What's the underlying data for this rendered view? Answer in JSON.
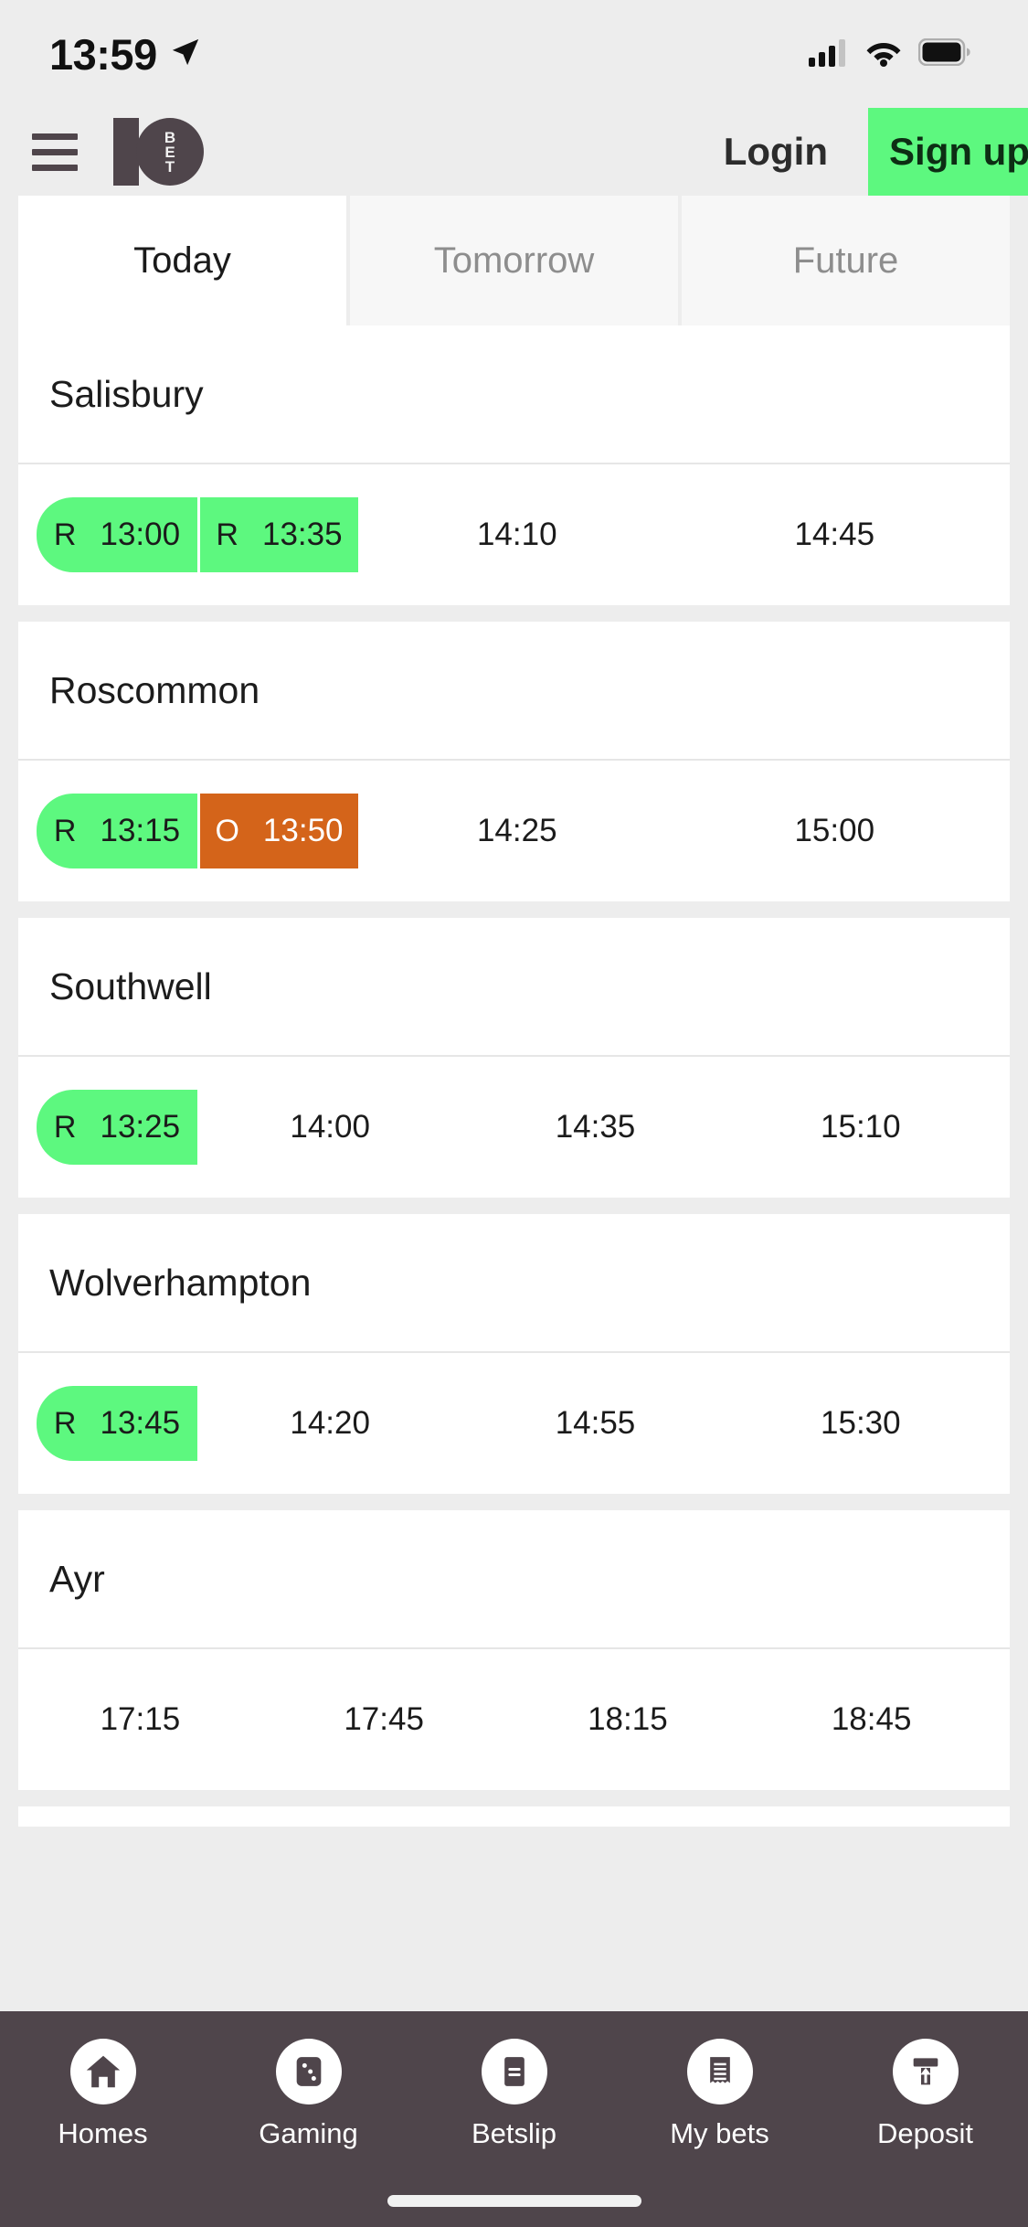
{
  "status_bar": {
    "time": "13:59",
    "location_icon": "location-arrow-icon",
    "cellular_icon": "cellular-signal-icon",
    "wifi_icon": "wifi-icon",
    "battery_icon": "battery-full-icon"
  },
  "header": {
    "menu_icon": "hamburger-menu-icon",
    "logo_digit": "1",
    "logo_letters": [
      "B",
      "E",
      "T"
    ],
    "login_label": "Login",
    "signup_label": "Sign up",
    "signup_bg": "#5df87f"
  },
  "tabs": [
    {
      "label": "Today",
      "active": true
    },
    {
      "label": "Tomorrow",
      "active": false
    },
    {
      "label": "Future",
      "active": false
    }
  ],
  "colors": {
    "green": "#5df87f",
    "orange": "#d4641a",
    "page_bg": "#ededed",
    "nav_bg": "#4f454b",
    "card_bg": "#ffffff"
  },
  "meetings": [
    {
      "venue": "Salisbury",
      "races": [
        {
          "time": "13:00",
          "tag": "R",
          "state": "green"
        },
        {
          "time": "13:35",
          "tag": "R",
          "state": "green"
        },
        {
          "time": "14:10",
          "tag": "",
          "state": "plain"
        },
        {
          "time": "14:45",
          "tag": "",
          "state": "plain"
        }
      ]
    },
    {
      "venue": "Roscommon",
      "races": [
        {
          "time": "13:15",
          "tag": "R",
          "state": "green"
        },
        {
          "time": "13:50",
          "tag": "O",
          "state": "orange"
        },
        {
          "time": "14:25",
          "tag": "",
          "state": "plain"
        },
        {
          "time": "15:00",
          "tag": "",
          "state": "plain"
        }
      ]
    },
    {
      "venue": "Southwell",
      "races": [
        {
          "time": "13:25",
          "tag": "R",
          "state": "green"
        },
        {
          "time": "14:00",
          "tag": "",
          "state": "plain"
        },
        {
          "time": "14:35",
          "tag": "",
          "state": "plain"
        },
        {
          "time": "15:10",
          "tag": "",
          "state": "plain"
        }
      ]
    },
    {
      "venue": "Wolverhampton",
      "races": [
        {
          "time": "13:45",
          "tag": "R",
          "state": "green"
        },
        {
          "time": "14:20",
          "tag": "",
          "state": "plain"
        },
        {
          "time": "14:55",
          "tag": "",
          "state": "plain"
        },
        {
          "time": "15:30",
          "tag": "",
          "state": "plain"
        }
      ]
    },
    {
      "venue": "Ayr",
      "races": [
        {
          "time": "17:15",
          "tag": "",
          "state": "plain"
        },
        {
          "time": "17:45",
          "tag": "",
          "state": "plain"
        },
        {
          "time": "18:15",
          "tag": "",
          "state": "plain"
        },
        {
          "time": "18:45",
          "tag": "",
          "state": "plain"
        }
      ]
    }
  ],
  "bottom_nav": [
    {
      "label": "Homes",
      "icon": "home-icon"
    },
    {
      "label": "Gaming",
      "icon": "dice-icon"
    },
    {
      "label": "Betslip",
      "icon": "betslip-card-icon"
    },
    {
      "label": "My bets",
      "icon": "receipt-icon"
    },
    {
      "label": "Deposit",
      "icon": "deposit-icon"
    }
  ]
}
